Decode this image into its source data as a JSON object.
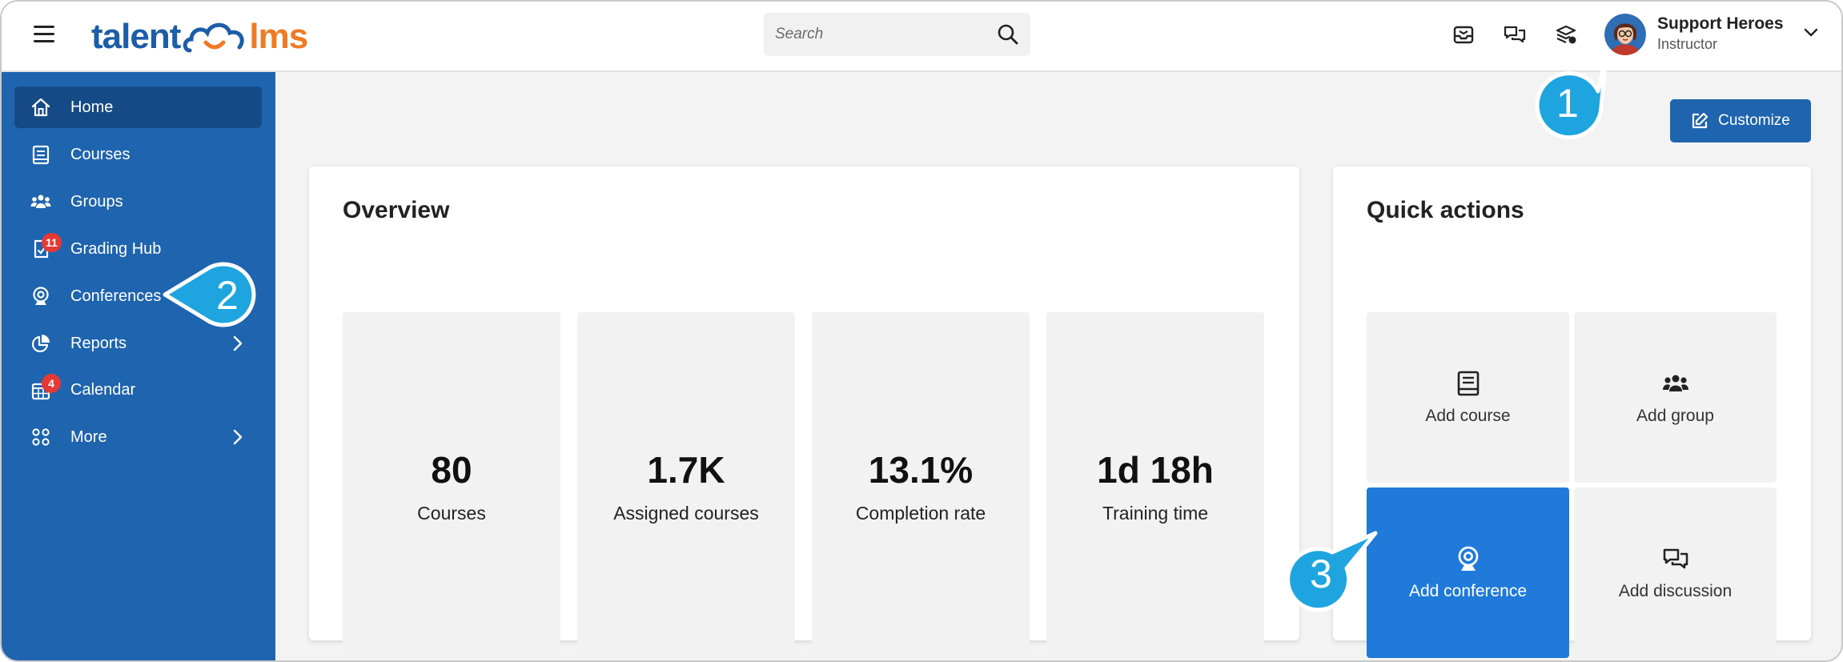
{
  "app": {
    "logo_part1": "talent",
    "logo_part2": "lms",
    "brand_colors": {
      "blue": "#1f64ae",
      "orange": "#f07a24"
    }
  },
  "topbar": {
    "search_placeholder": "Search",
    "icons": [
      "inbox-icon",
      "messages-icon",
      "courses-store-icon"
    ],
    "user": {
      "name": "Support Heroes",
      "role": "Instructor"
    }
  },
  "sidebar": {
    "items": [
      {
        "label": "Home",
        "icon": "home-icon",
        "active": true
      },
      {
        "label": "Courses",
        "icon": "book-icon"
      },
      {
        "label": "Groups",
        "icon": "groups-icon"
      },
      {
        "label": "Grading Hub",
        "icon": "grading-icon",
        "badge": "11"
      },
      {
        "label": "Conferences",
        "icon": "webcam-icon"
      },
      {
        "label": "Reports",
        "icon": "pie-chart-icon",
        "has_submenu": true
      },
      {
        "label": "Calendar",
        "icon": "calendar-icon",
        "badge": "4"
      },
      {
        "label": "More",
        "icon": "grid-icon",
        "has_submenu": true
      }
    ]
  },
  "main": {
    "customize_label": "Customize",
    "overview": {
      "title": "Overview",
      "stats": [
        {
          "value": "80",
          "label": "Courses"
        },
        {
          "value": "1.7K",
          "label": "Assigned courses"
        },
        {
          "value": "13.1%",
          "label": "Completion rate"
        },
        {
          "value": "1d 18h",
          "label": "Training time"
        }
      ]
    },
    "quick_actions": {
      "title": "Quick actions",
      "items": [
        {
          "label": "Add course",
          "icon": "book-icon"
        },
        {
          "label": "Add group",
          "icon": "groups-icon"
        },
        {
          "label": "Add conference",
          "icon": "webcam-icon",
          "highlighted": true
        },
        {
          "label": "Add discussion",
          "icon": "chat-icon"
        }
      ]
    }
  },
  "callouts": [
    "1",
    "2",
    "3"
  ],
  "callout_color": "#1ea5e0"
}
